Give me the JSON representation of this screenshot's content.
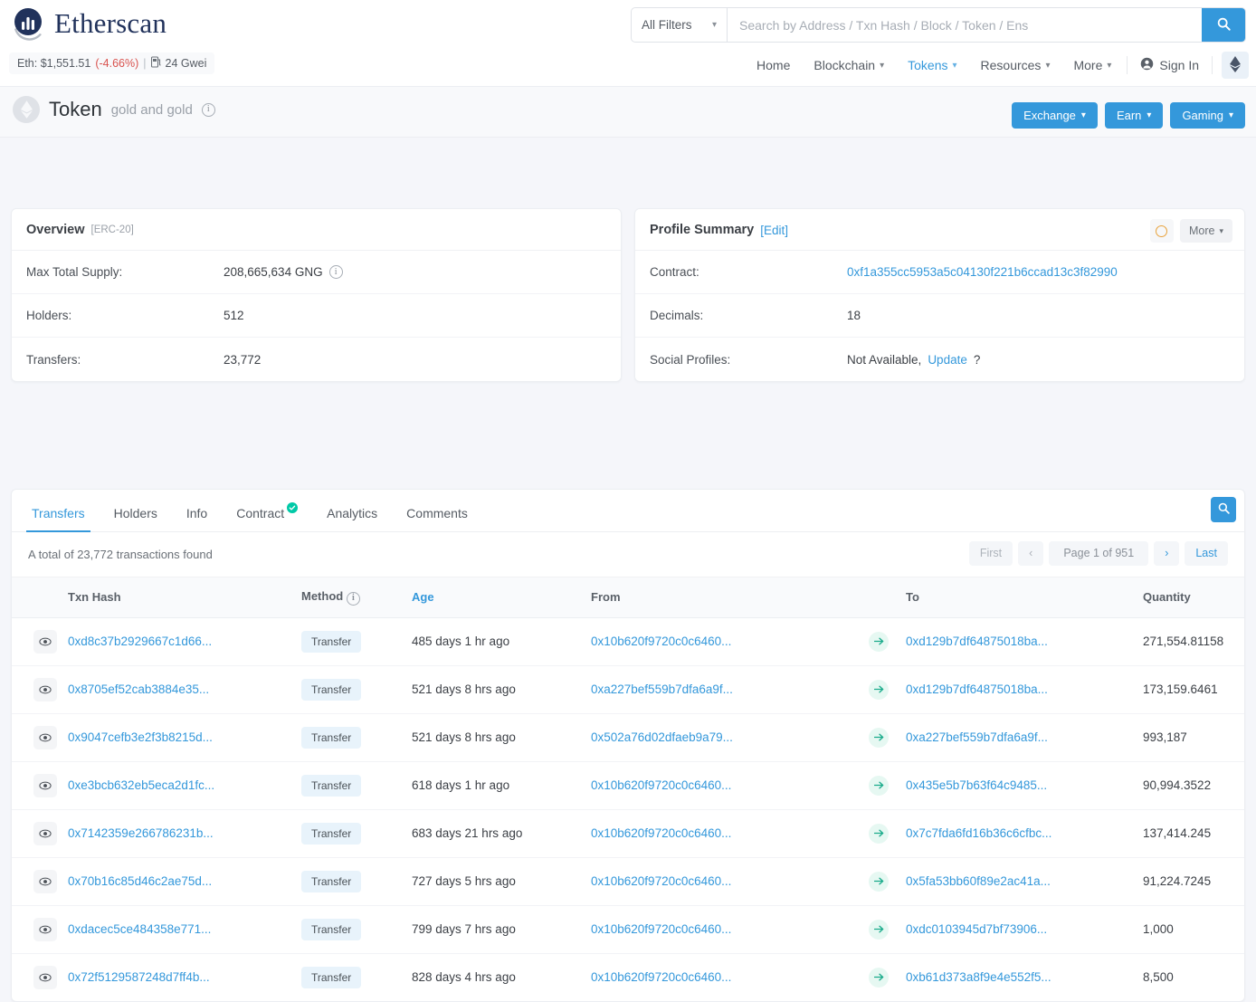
{
  "brand": {
    "name": "Etherscan",
    "logo_icon": "etherscan-logo-icon"
  },
  "eth_stats": {
    "price_label": "Eth: $1,551.51",
    "change": "(-4.66%)",
    "separator": "|",
    "gas": "24 Gwei",
    "gas_icon": "gas-pump-icon"
  },
  "search": {
    "filter_label": "All Filters",
    "placeholder": "Search by Address / Txn Hash / Block / Token / Ens",
    "value": "",
    "search_icon": "search-icon",
    "chevron_icon": "chevron-down-icon"
  },
  "nav": {
    "items": [
      {
        "label": "Home",
        "has_caret": false,
        "active": false
      },
      {
        "label": "Blockchain",
        "has_caret": true,
        "active": false
      },
      {
        "label": "Tokens",
        "has_caret": true,
        "active": true
      },
      {
        "label": "Resources",
        "has_caret": true,
        "active": false
      },
      {
        "label": "More",
        "has_caret": true,
        "active": false
      }
    ],
    "sign_in": "Sign In",
    "sign_in_icon": "user-circle-icon",
    "eth_button_icon": "ethereum-diamond-icon"
  },
  "token_header": {
    "icon": "token-ethereum-icon",
    "title": "Token",
    "subtitle": "gold and gold",
    "info_icon": "info-circle-icon",
    "buttons": [
      {
        "label": "Exchange",
        "caret": "chevron-down-icon"
      },
      {
        "label": "Earn",
        "caret": "chevron-down-icon"
      },
      {
        "label": "Gaming",
        "caret": "chevron-down-icon"
      }
    ]
  },
  "overview": {
    "title": "Overview",
    "tag": "[ERC-20]",
    "rows": [
      {
        "label": "Max Total Supply:",
        "value": "208,665,634 GNG",
        "info_icon": "info-circle-icon"
      },
      {
        "label": "Holders:",
        "value": "512",
        "info_icon": ""
      },
      {
        "label": "Transfers:",
        "value": "23,772",
        "info_icon": ""
      }
    ]
  },
  "profile": {
    "title": "Profile Summary",
    "edit_label": "[Edit]",
    "badge_icon": "ring-circle-icon",
    "more_label": "More",
    "more_caret": "chevron-down-icon",
    "contract_label": "Contract:",
    "contract_value": "0xf1a355cc5953a5c04130f221b6ccad13c3f82990",
    "decimals_label": "Decimals:",
    "decimals_value": "18",
    "social_label": "Social Profiles:",
    "social_value": "Not Available,",
    "social_update": "Update",
    "social_suffix": "?"
  },
  "panel": {
    "tabs": [
      {
        "label": "Transfers",
        "active": true,
        "verified": false
      },
      {
        "label": "Holders",
        "active": false,
        "verified": false
      },
      {
        "label": "Info",
        "active": false,
        "verified": false
      },
      {
        "label": "Contract",
        "active": false,
        "verified": true
      },
      {
        "label": "Analytics",
        "active": false,
        "verified": false
      },
      {
        "label": "Comments",
        "active": false,
        "verified": false
      }
    ],
    "search_icon": "search-icon",
    "total_text": "A total of 23,772 transactions found",
    "pagination": {
      "first": "First",
      "prev_icon": "chevron-left-icon",
      "current": "Page 1 of 951",
      "next_icon": "chevron-right-icon",
      "last": "Last"
    },
    "columns": {
      "eye": "",
      "hash": "Txn Hash",
      "method": "Method",
      "method_info_icon": "info-circle-icon",
      "age": "Age",
      "from": "From",
      "arrow": "",
      "to": "To",
      "quantity": "Quantity"
    },
    "rows": [
      {
        "eye_icon": "eye-icon",
        "hash": "0xd8c37b2929667c1d66...",
        "method": "Transfer",
        "age": "485 days 1 hr ago",
        "from": "0x10b620f9720c0c6460...",
        "arrow_icon": "arrow-right-icon",
        "to": "0xd129b7df64875018ba...",
        "quantity": "271,554.81158"
      },
      {
        "eye_icon": "eye-icon",
        "hash": "0x8705ef52cab3884e35...",
        "method": "Transfer",
        "age": "521 days 8 hrs ago",
        "from": "0xa227bef559b7dfa6a9f...",
        "arrow_icon": "arrow-right-icon",
        "to": "0xd129b7df64875018ba...",
        "quantity": "173,159.6461"
      },
      {
        "eye_icon": "eye-icon",
        "hash": "0x9047cefb3e2f3b8215d...",
        "method": "Transfer",
        "age": "521 days 8 hrs ago",
        "from": "0x502a76d02dfaeb9a79...",
        "arrow_icon": "arrow-right-icon",
        "to": "0xa227bef559b7dfa6a9f...",
        "quantity": "993,187"
      },
      {
        "eye_icon": "eye-icon",
        "hash": "0xe3bcb632eb5eca2d1fc...",
        "method": "Transfer",
        "age": "618 days 1 hr ago",
        "from": "0x10b620f9720c0c6460...",
        "arrow_icon": "arrow-right-icon",
        "to": "0x435e5b7b63f64c9485...",
        "quantity": "90,994.3522"
      },
      {
        "eye_icon": "eye-icon",
        "hash": "0x7142359e266786231b...",
        "method": "Transfer",
        "age": "683 days 21 hrs ago",
        "from": "0x10b620f9720c0c6460...",
        "arrow_icon": "arrow-right-icon",
        "to": "0x7c7fda6fd16b36c6cfbc...",
        "quantity": "137,414.245"
      },
      {
        "eye_icon": "eye-icon",
        "hash": "0x70b16c85d46c2ae75d...",
        "method": "Transfer",
        "age": "727 days 5 hrs ago",
        "from": "0x10b620f9720c0c6460...",
        "arrow_icon": "arrow-right-icon",
        "to": "0x5fa53bb60f89e2ac41a...",
        "quantity": "91,224.7245"
      },
      {
        "eye_icon": "eye-icon",
        "hash": "0xdacec5ce484358e771...",
        "method": "Transfer",
        "age": "799 days 7 hrs ago",
        "from": "0x10b620f9720c0c6460...",
        "arrow_icon": "arrow-right-icon",
        "to": "0xdc0103945d7bf73906...",
        "quantity": "1,000"
      },
      {
        "eye_icon": "eye-icon",
        "hash": "0x72f5129587248d7ff4b...",
        "method": "Transfer",
        "age": "828 days 4 hrs ago",
        "from": "0x10b620f9720c0c6460...",
        "arrow_icon": "arrow-right-icon",
        "to": "0xb61d373a8f9e4e552f5...",
        "quantity": "8,500"
      }
    ]
  },
  "colors": {
    "accent": "#3498db",
    "brand_navy": "#21325b",
    "negative": "#d9534f",
    "verified_green": "#00c9a7",
    "page_bg": "#f5f6fa"
  }
}
